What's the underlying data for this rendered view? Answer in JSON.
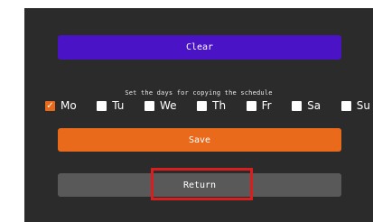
{
  "buttons": {
    "clear": "Clear",
    "save": "Save",
    "return": "Return"
  },
  "instruction": "Set the days for copying the schedule",
  "days": [
    {
      "label": "Mo",
      "checked": true
    },
    {
      "label": "Tu",
      "checked": false
    },
    {
      "label": "We",
      "checked": false
    },
    {
      "label": "Th",
      "checked": false
    },
    {
      "label": "Fr",
      "checked": false
    },
    {
      "label": "Sa",
      "checked": false
    },
    {
      "label": "Su",
      "checked": false
    }
  ],
  "colors": {
    "panel_bg": "#2b2b2b",
    "clear_button": "#4a14c6",
    "save_button": "#ea6a1c",
    "return_button": "#595959",
    "checkbox_checked": "#ea6a1c",
    "highlight": "#d81e1e"
  },
  "icons": {
    "checkmark": "checkmark-icon"
  }
}
